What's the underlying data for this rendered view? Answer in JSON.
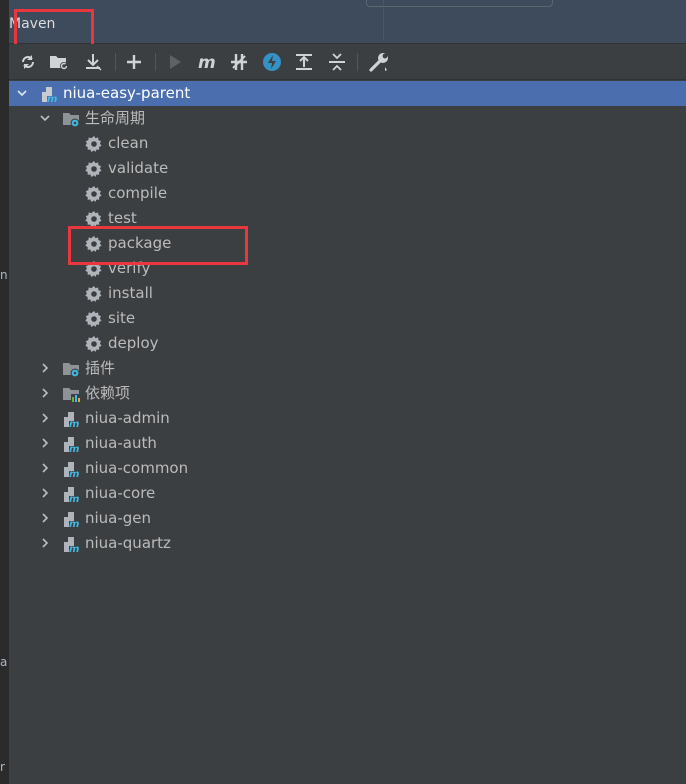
{
  "panel": {
    "title": "Maven"
  },
  "left_strip": {
    "marks": [
      "n",
      "a",
      "r"
    ]
  },
  "toolbar": {
    "buttons": [
      {
        "name": "reload-all-icon",
        "glyph": "reload"
      },
      {
        "name": "add-sources-icon",
        "glyph": "folder-reload"
      },
      {
        "name": "download-icon",
        "glyph": "download"
      },
      {
        "name": "add-maven-project-icon",
        "glyph": "plus"
      },
      {
        "name": "run-icon",
        "glyph": "play"
      },
      {
        "name": "execute-goal-icon",
        "glyph": "m"
      },
      {
        "name": "toggle-offline-icon",
        "glyph": "offline"
      },
      {
        "name": "skip-tests-icon",
        "glyph": "bolt"
      },
      {
        "name": "show-dependencies-icon",
        "glyph": "deps"
      },
      {
        "name": "collapse-all-icon",
        "glyph": "collapse"
      },
      {
        "name": "settings-icon",
        "glyph": "wrench"
      }
    ]
  },
  "tree": {
    "root": {
      "label": "niua-easy-parent",
      "icon": "maven-module-icon",
      "expanded": true
    },
    "lifecycle": {
      "label": "生命周期",
      "icon": "folder-gear-icon",
      "expanded": true,
      "goals": [
        "clean",
        "validate",
        "compile",
        "test",
        "package",
        "verify",
        "install",
        "site",
        "deploy"
      ]
    },
    "plugins": {
      "label": "插件",
      "icon": "folder-gear-icon"
    },
    "dependencies": {
      "label": "依赖项",
      "icon": "folder-chart-icon"
    },
    "modules": [
      "niua-admin",
      "niua-auth",
      "niua-common",
      "niua-core",
      "niua-gen",
      "niua-quartz"
    ]
  },
  "colors": {
    "accent_selection": "#4b6eaf",
    "highlight_box": "#e8383d",
    "maven_blue": "#40b6e0"
  }
}
